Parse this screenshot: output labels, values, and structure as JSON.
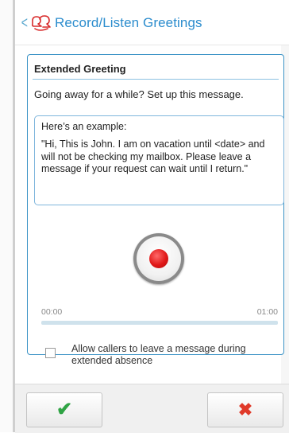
{
  "header": {
    "title": "Record/Listen Greetings",
    "back_icon": "chevron-left-icon",
    "brand_icon": "people-icon",
    "accent_color": "#2b8ccd"
  },
  "greeting": {
    "heading": "Extended Greeting",
    "description": "Going away for a while? Set up this message.",
    "example_title": "Here’s an example:",
    "example_text": "\"Hi, This is John. I am on vacation until <date> and will not be checking my mailbox. Please leave a message if your request can wait until I return.\""
  },
  "recorder": {
    "record_icon": "record-icon",
    "record_color": "#e01818",
    "time_start": "00:00",
    "time_end": "01:00",
    "progress": 0
  },
  "options": {
    "allow_callers_label": "Allow callers to leave a message during extended absence",
    "allow_callers_checked": false
  },
  "actions": {
    "confirm_icon": "checkmark-icon",
    "confirm_glyph": "✔",
    "confirm_color": "#2fa344",
    "cancel_icon": "close-icon",
    "cancel_glyph": "✖",
    "cancel_color": "#e03a2a"
  }
}
